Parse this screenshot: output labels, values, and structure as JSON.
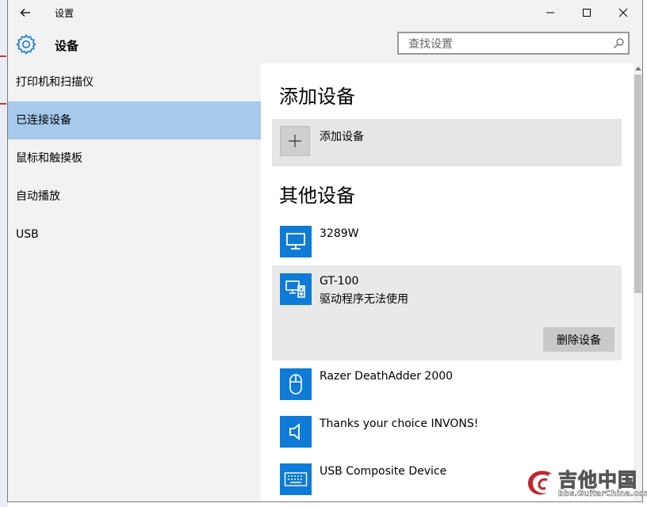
{
  "window": {
    "title": "设置",
    "controls": {
      "back": "back-arrow-icon",
      "minimize": "minimize-icon",
      "maximize": "maximize-icon",
      "close": "close-icon"
    }
  },
  "header": {
    "icon": "gear-icon",
    "title": "设备",
    "search": {
      "placeholder": "查找设置",
      "value": "",
      "icon": "search-icon"
    }
  },
  "sidebar": {
    "items": [
      {
        "label": "打印机和扫描仪",
        "active": false
      },
      {
        "label": "已连接设备",
        "active": true
      },
      {
        "label": "鼠标和触摸板",
        "active": false
      },
      {
        "label": "自动播放",
        "active": false
      },
      {
        "label": "USB",
        "active": false
      }
    ]
  },
  "main": {
    "add_section": {
      "title": "添加设备",
      "button_label": "添加设备",
      "icon": "plus-icon"
    },
    "other_section": {
      "title": "其他设备",
      "devices": [
        {
          "name": "3289W",
          "status": "",
          "icon": "monitor-icon"
        },
        {
          "name": "GT-100",
          "status": "驱动程序无法使用",
          "icon": "multimedia-device-icon",
          "selected": true,
          "action_label": "删除设备"
        },
        {
          "name": "Razer DeathAdder 2000",
          "status": "",
          "icon": "mouse-icon"
        },
        {
          "name": "Thanks your choice INVONS!",
          "status": "",
          "icon": "speaker-icon"
        },
        {
          "name": "USB Composite Device",
          "status": "",
          "icon": "keyboard-icon"
        }
      ]
    }
  },
  "watermark": {
    "text": "吉他中国",
    "url": "bbs.GuitarChina.com"
  },
  "colors": {
    "accent": "#0f7bd6",
    "selected_nav": "#a6c9ec",
    "chrome": "#f2f2f2",
    "tile": "#e6e6e6"
  }
}
